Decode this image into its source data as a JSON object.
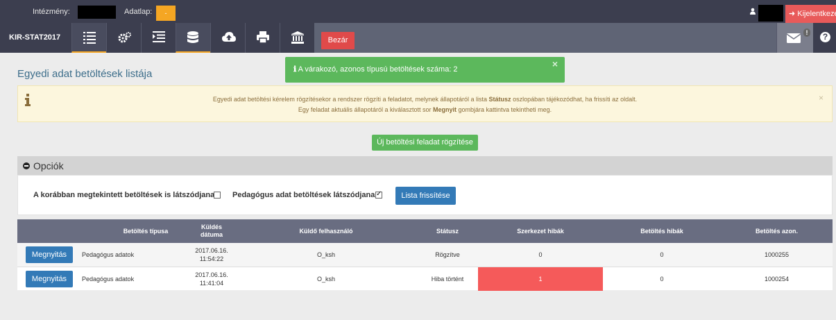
{
  "topbar": {
    "institution_label": "Intézmény:",
    "datasheet_label": "Adatlap:",
    "datasheet_value": "-",
    "logout_label": "Kijelentkezés"
  },
  "navbar": {
    "brand": "KIR-STAT2017",
    "close_label": "Bezár",
    "icons": [
      "list-icon",
      "cogs-icon",
      "indent-icon",
      "database-icon",
      "cloud-upload-icon",
      "print-icon",
      "institution-icon"
    ],
    "mail_badge": "!",
    "help": "?"
  },
  "page": {
    "title": "Egyedi adat betöltések listája"
  },
  "toast": {
    "icon": "ℹ",
    "text": "A várakozó, azonos típusú betöltések száma: 2",
    "close": "×"
  },
  "alert": {
    "line1_a": "Egyedi adat betöltési kérelem rögzítésekor a rendszer rögzíti a feladatot, melynek állapotáról a lista ",
    "line1_b": "Státusz",
    "line1_c": " oszlopában tájékozódhat, ha frissíti az oldalt.",
    "line2_a": "Egy feladat aktuális állapotáról a kiválasztott sor ",
    "line2_b": "Megnyit",
    "line2_c": " gombjára kattintva tekintheti meg.",
    "close": "×"
  },
  "new_task_button": "Új betöltési feladat rögzítése",
  "options": {
    "title": "Opciók",
    "show_viewed_label": "A korábban megtekintett betöltések is látszódjanak",
    "show_viewed_checked": false,
    "teacher_label": "Pedagógus adat betöltések látszódjanak",
    "teacher_checked": true,
    "refresh_button": "Lista frissítése"
  },
  "table": {
    "headers": {
      "type": "Betöltés típusa",
      "date": "Küldés\ndátuma",
      "user": "Küldő felhasználó",
      "status": "Státusz",
      "struct_errors": "Szerkezet hibák",
      "load_errors": "Betöltés hibák",
      "load_id": "Betöltés azon."
    },
    "open_label": "Megnyitás",
    "rows": [
      {
        "type": "Pedagógus adatok",
        "date": "2017.06.16.",
        "time": "11:54:22",
        "user": "O_ksh",
        "status": "Rögzítve",
        "struct_errors": "0",
        "load_errors": "0",
        "load_id": "1000255"
      },
      {
        "type": "Pedagógus adatok",
        "date": "2017.06.16.",
        "time": "11:41:04",
        "user": "O_ksh",
        "status": "Hiba történt",
        "struct_errors": "1",
        "load_errors": "0",
        "load_id": "1000254"
      }
    ]
  },
  "colors": {
    "topbar": "#3c3e4f",
    "accent_orange": "#f5a623",
    "success": "#5cb85c",
    "primary": "#337ab7",
    "danger": "#f55a5a"
  }
}
